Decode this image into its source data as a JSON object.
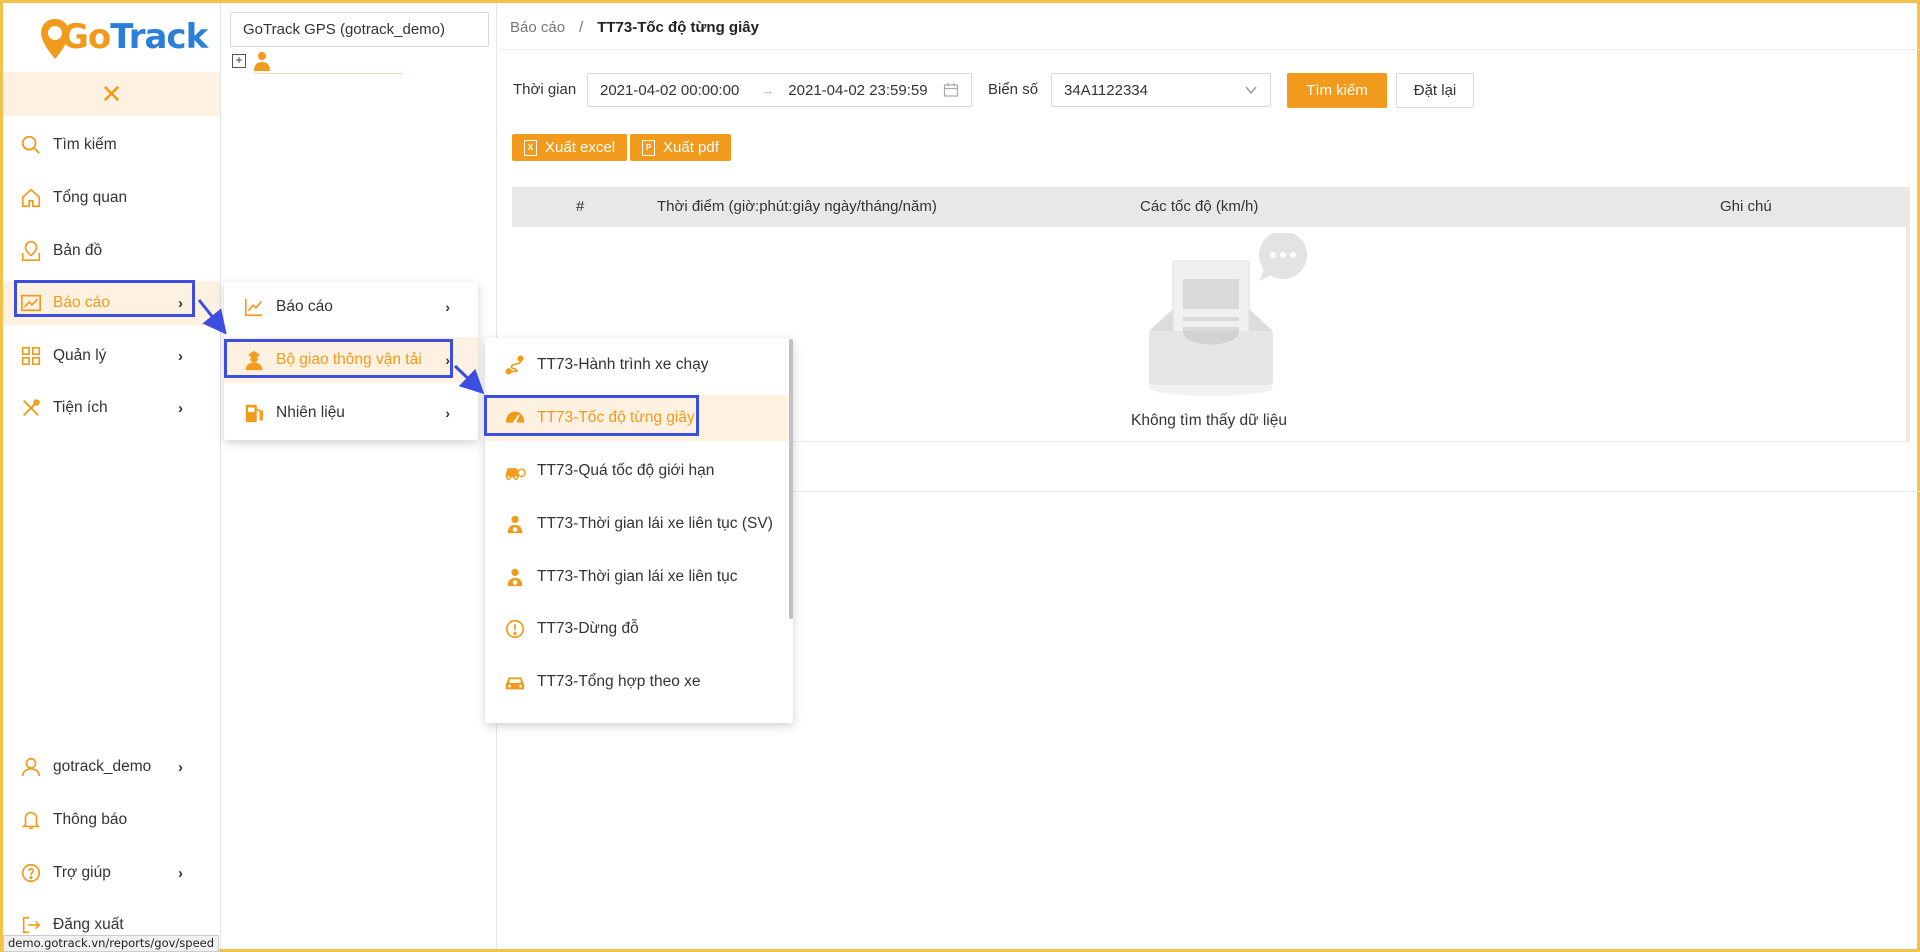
{
  "brand": {
    "logo_text_go": "Go",
    "logo_text_track": "Track"
  },
  "sidebar": {
    "top_items": [
      {
        "label": "Tìm kiếm",
        "icon": "search-icon"
      },
      {
        "label": "Tổng quan",
        "icon": "home-icon"
      },
      {
        "label": "Bản đồ",
        "icon": "map-icon"
      },
      {
        "label": "Báo cáo",
        "icon": "chart-icon",
        "active": true
      },
      {
        "label": "Quản lý",
        "icon": "grid-icon"
      },
      {
        "label": "Tiện ích",
        "icon": "tools-icon"
      }
    ],
    "bottom_items": [
      {
        "label": "gotrack_demo",
        "icon": "user-icon"
      },
      {
        "label": "Thông báo",
        "icon": "bell-icon"
      },
      {
        "label": "Trợ giúp",
        "icon": "help-icon"
      },
      {
        "label": "Đăng xuất",
        "icon": "logout-icon"
      }
    ],
    "close_glyph": "✕",
    "chevron": "›"
  },
  "tree": {
    "company": "GoTrack GPS (gotrack_demo)",
    "toggle": "+"
  },
  "submenu_1": {
    "items": [
      {
        "label": "Báo cáo",
        "icon": "line-chart-icon"
      },
      {
        "label": "Bộ giao thông vận tải",
        "icon": "officer-icon"
      },
      {
        "label": "Nhiên liệu",
        "icon": "fuel-icon"
      }
    ]
  },
  "submenu_2": {
    "items": [
      {
        "label": "TT73-Hành trình xe chạy",
        "icon": "route-icon"
      },
      {
        "label": "TT73-Tốc độ từng giây",
        "icon": "speedometer-icon"
      },
      {
        "label": "TT73-Quá tốc độ giới hạn",
        "icon": "car-speed-icon"
      },
      {
        "label": "TT73-Thời gian lái xe liên tục (SV)",
        "icon": "driver-icon"
      },
      {
        "label": "TT73-Thời gian lái xe liên tục",
        "icon": "driver-icon"
      },
      {
        "label": "TT73-Dừng đỗ",
        "icon": "alert-circle-icon"
      },
      {
        "label": "TT73-Tổng hợp theo xe",
        "icon": "car-icon"
      }
    ]
  },
  "breadcrumb": {
    "parent": "Báo cáo",
    "separator": "/",
    "current": "TT73-Tốc độ từng giây"
  },
  "filters": {
    "time_label": "Thời gian",
    "date_from": "2021-04-02 00:00:00",
    "date_arrow": "→",
    "date_to": "2021-04-02 23:59:59",
    "plate_label": "Biển số",
    "plate_value": "34A1122334",
    "search_button": "Tìm kiếm",
    "reset_button": "Đặt lại"
  },
  "exports": {
    "excel": "Xuất excel",
    "pdf": "Xuất pdf",
    "excel_glyph": "X",
    "pdf_glyph": "P"
  },
  "table": {
    "columns": [
      "#",
      "Thời điểm (giờ:phút:giây ngày/tháng/năm)",
      "Các tốc độ (km/h)",
      "Ghi chú"
    ],
    "empty_text": "Không tìm thấy dữ liệu"
  },
  "status_bar": {
    "url": "demo.gotrack.vn/reports/gov/speed"
  },
  "colors": {
    "accent": "#f29a1c",
    "highlight": "#3b4ee0",
    "active_bg": "#fdf1e2"
  }
}
